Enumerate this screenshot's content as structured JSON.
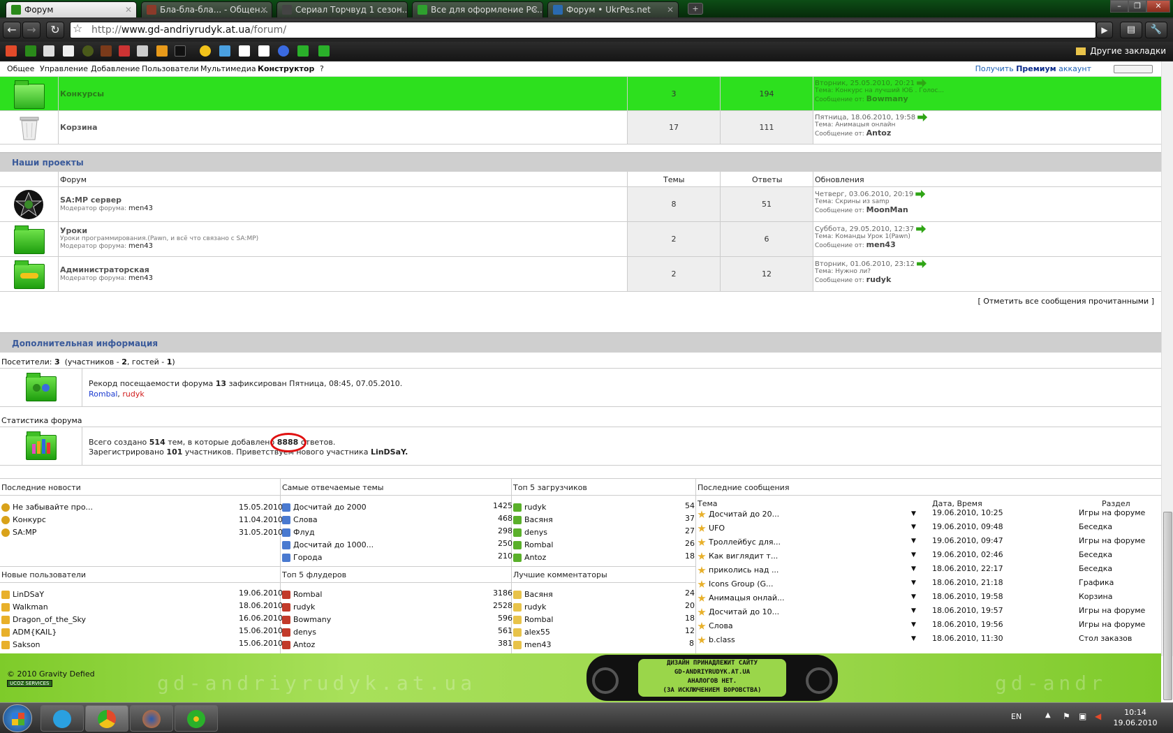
{
  "browser": {
    "tabs": [
      {
        "title": "Форум",
        "active": true,
        "color": "#2a8a1a"
      },
      {
        "title": "Бла-бла-бла... - Общен...",
        "active": false,
        "color": "#8a3a2a"
      },
      {
        "title": "Сериал Торчвуд 1 сезон...",
        "active": false,
        "color": "#333"
      },
      {
        "title": "Все для оформление PC...",
        "active": false,
        "color": "#2ea02e"
      },
      {
        "title": "Форум • UkrPes.net",
        "active": false,
        "color": "#2a6ab0"
      }
    ],
    "url_prefix": "http://",
    "url_host": "www.gd-andriyrudyk.at.ua",
    "url_path": "/forum/",
    "other_bookmarks": "Другие закладки"
  },
  "menu": {
    "items": [
      "Общее",
      "Управление",
      "Добавление",
      "Пользователи",
      "Мультимедиа",
      "Конструктор",
      "?"
    ],
    "premium_prefix": "Получить",
    "premium_bold": "Премиум",
    "premium_suffix": "аккаунт"
  },
  "forums_top": [
    {
      "name": "Конкурсы",
      "topics": "3",
      "replies": "194",
      "date": "Вторник, 25.05.2010, 20:21",
      "topic_label": "Тема:",
      "topic": "Конкурс на лучший ЮБ . Голос...",
      "author_label": "Сообщение от:",
      "author": "Bowmany",
      "highlight": true
    },
    {
      "name": "Корзина",
      "topics": "17",
      "replies": "111",
      "date": "Пятница, 18.06.2010, 19:58",
      "topic_label": "Тема:",
      "topic": "Анимацыя онлайн",
      "author_label": "Сообщение от:",
      "author": "Antoz",
      "highlight": false
    }
  ],
  "projects": {
    "title": "Наши проекты",
    "headers": {
      "forum": "Форум",
      "topics": "Темы",
      "replies": "Ответы",
      "updates": "Обновления"
    },
    "rows": [
      {
        "name": "SA:MP сервер",
        "desc": "",
        "mod_label": "Модератор форума:",
        "mod": "men43",
        "topics": "8",
        "replies": "51",
        "date": "Четверг, 03.06.2010, 20:19",
        "topic": "Скрины из samp",
        "author": "MoonMan"
      },
      {
        "name": "Уроки",
        "desc": "Уроки программирования.(Pawn, и всё что связано с SA:MP)",
        "mod_label": "Модератор форума:",
        "mod": "men43",
        "topics": "2",
        "replies": "6",
        "date": "Суббота, 29.05.2010, 12:37",
        "topic": "Команды Урок 1(Pawn)",
        "author": "men43"
      },
      {
        "name": "Администраторская",
        "desc": "",
        "mod_label": "Модератор форума:",
        "mod": "men43",
        "topics": "2",
        "replies": "12",
        "date": "Вторник, 01.06.2010, 23:12",
        "topic": "Нужно ли?",
        "author": "rudyk"
      }
    ],
    "topic_label": "Тема:",
    "author_label": "Сообщение от:"
  },
  "mark_read": "[ Отметить все сообщения прочитанными ]",
  "info": {
    "title": "Дополнительная информация",
    "visitors_prefix": "Посетители:",
    "visitors_total": "3",
    "visitors_detail_1": "(участников -",
    "visitors_members": "2",
    "visitors_detail_2": ", гостей -",
    "visitors_guests": "1",
    "visitors_detail_3": ")",
    "record_prefix": "Рекорд посещаемости форума",
    "record_count": "13",
    "record_suffix": "зафиксирован Пятница, 08:45, 07.05.2010.",
    "online_1": "Rombal",
    "online_sep": ",",
    "online_2": "rudyk",
    "stats_title": "Статистика форума",
    "stats_1": "Всего создано",
    "stats_topics": "514",
    "stats_2": "тем, в которые добавлено",
    "stats_replies": "8888",
    "stats_3": "ответов.",
    "stats_4": "Зарегистрировано",
    "stats_members": "101",
    "stats_5": "участников. Приветствуем нового участника",
    "stats_newest": "LinDSaY."
  },
  "panels": {
    "news": {
      "title": "Последние новости",
      "items": [
        {
          "t": "Не забывайте про...",
          "v": "15.05.2010"
        },
        {
          "t": "Конкурс",
          "v": "11.04.2010"
        },
        {
          "t": "SA:MP",
          "v": "31.05.2010"
        }
      ]
    },
    "popular": {
      "title": "Самые отвечаемые темы",
      "items": [
        {
          "t": "Досчитай до 2000",
          "v": "1425"
        },
        {
          "t": "Слова",
          "v": "468"
        },
        {
          "t": "Флуд",
          "v": "298"
        },
        {
          "t": "Досчитай до 1000...",
          "v": "250"
        },
        {
          "t": "Города",
          "v": "210"
        }
      ]
    },
    "uploaders": {
      "title": "Топ 5 загрузчиков",
      "items": [
        {
          "t": "rudyk",
          "v": "54"
        },
        {
          "t": "Васяня",
          "v": "37"
        },
        {
          "t": "denys",
          "v": "27"
        },
        {
          "t": "Rombal",
          "v": "26"
        },
        {
          "t": "Antoz",
          "v": "18"
        }
      ]
    },
    "new_users": {
      "title": "Новые пользователи",
      "items": [
        {
          "t": "LinDSaY",
          "v": "19.06.2010"
        },
        {
          "t": "Walkman",
          "v": "18.06.2010"
        },
        {
          "t": "Dragon_of_the_Sky",
          "v": "16.06.2010"
        },
        {
          "t": "ADM{KAIL}",
          "v": "15.06.2010"
        },
        {
          "t": "Sakson",
          "v": "15.06.2010"
        }
      ]
    },
    "flooders": {
      "title": "Топ 5 флудеров",
      "items": [
        {
          "t": "Rombal",
          "v": "3186"
        },
        {
          "t": "rudyk",
          "v": "2528"
        },
        {
          "t": "Bowmany",
          "v": "596"
        },
        {
          "t": "denys",
          "v": "561"
        },
        {
          "t": "Antoz",
          "v": "381"
        }
      ]
    },
    "commenters": {
      "title": "Лучшие комментаторы",
      "items": [
        {
          "t": "Васяня",
          "v": "24"
        },
        {
          "t": "rudyk",
          "v": "20"
        },
        {
          "t": "Rombal",
          "v": "18"
        },
        {
          "t": "alex55",
          "v": "12"
        },
        {
          "t": "men43",
          "v": "8"
        }
      ]
    },
    "recent": {
      "title": "Последние сообщения",
      "headers": {
        "topic": "Тема",
        "date": "Дата, Время",
        "section": "Раздел"
      },
      "items": [
        {
          "t": "Досчитай до 20...",
          "d": "19.06.2010, 10:25",
          "s": "Игры на форуме"
        },
        {
          "t": "UFO",
          "d": "19.06.2010, 09:48",
          "s": "Беседка"
        },
        {
          "t": "Троллейбус для...",
          "d": "19.06.2010, 09:47",
          "s": "Игры на форуме"
        },
        {
          "t": "Как виглядит т...",
          "d": "19.06.2010, 02:46",
          "s": "Беседка"
        },
        {
          "t": "приколись над ...",
          "d": "18.06.2010, 22:17",
          "s": "Беседка"
        },
        {
          "t": "Icons Group (G...",
          "d": "18.06.2010, 21:18",
          "s": "Графика"
        },
        {
          "t": "Анимацыя онлай...",
          "d": "18.06.2010, 19:58",
          "s": "Корзина"
        },
        {
          "t": "Досчитай до 10...",
          "d": "18.06.2010, 19:57",
          "s": "Игры на форуме"
        },
        {
          "t": "Слова",
          "d": "18.06.2010, 19:56",
          "s": "Игры на форуме"
        },
        {
          "t": "b.class",
          "d": "18.06.2010, 11:30",
          "s": "Стол заказов"
        }
      ]
    }
  },
  "footer": {
    "copyright": "© 2010 Gravity Defied",
    "badge": "UCOZ SERVICES",
    "logo_left": "gd-andriyrudyk.at.ua",
    "banner_1": "ДИЗАЙН ПРИНАДЛЕЖИТ САЙТУ",
    "banner_2": "GD-ANDRIYRUDYK.AT.UA",
    "banner_3": "АНАЛОГОВ НЕТ.",
    "banner_4": "(ЗА ИСКЛЮЧЕНИЕМ ВОРОВСТВА)",
    "logo_right": "gd-andr"
  },
  "taskbar": {
    "lang": "EN",
    "time": "10:14",
    "date": "19.06.2010"
  }
}
